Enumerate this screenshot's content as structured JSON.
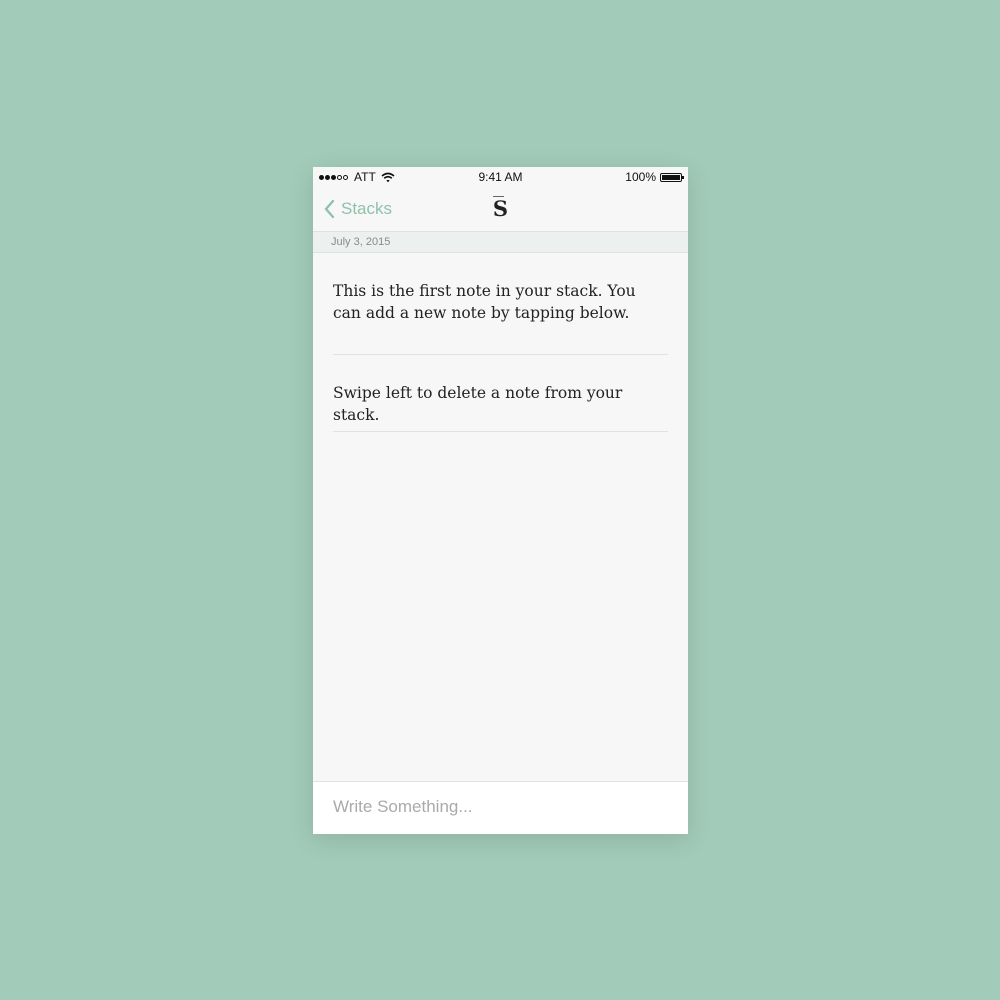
{
  "status_bar": {
    "carrier": "ATT",
    "time": "9:41 AM",
    "battery": "100%",
    "signal_filled": 3,
    "signal_total": 5
  },
  "nav": {
    "back_label": "Stacks",
    "logo": "S"
  },
  "date_header": "July 3, 2015",
  "notes": [
    "This is the first note in your stack. You can add a new note by tapping below.",
    "Swipe left to delete a note from your stack."
  ],
  "compose": {
    "placeholder": "Write Something...",
    "value": ""
  },
  "colors": {
    "background": "#a2cbb9",
    "accent": "#8fc2ab",
    "surface": "#f7f7f7"
  }
}
